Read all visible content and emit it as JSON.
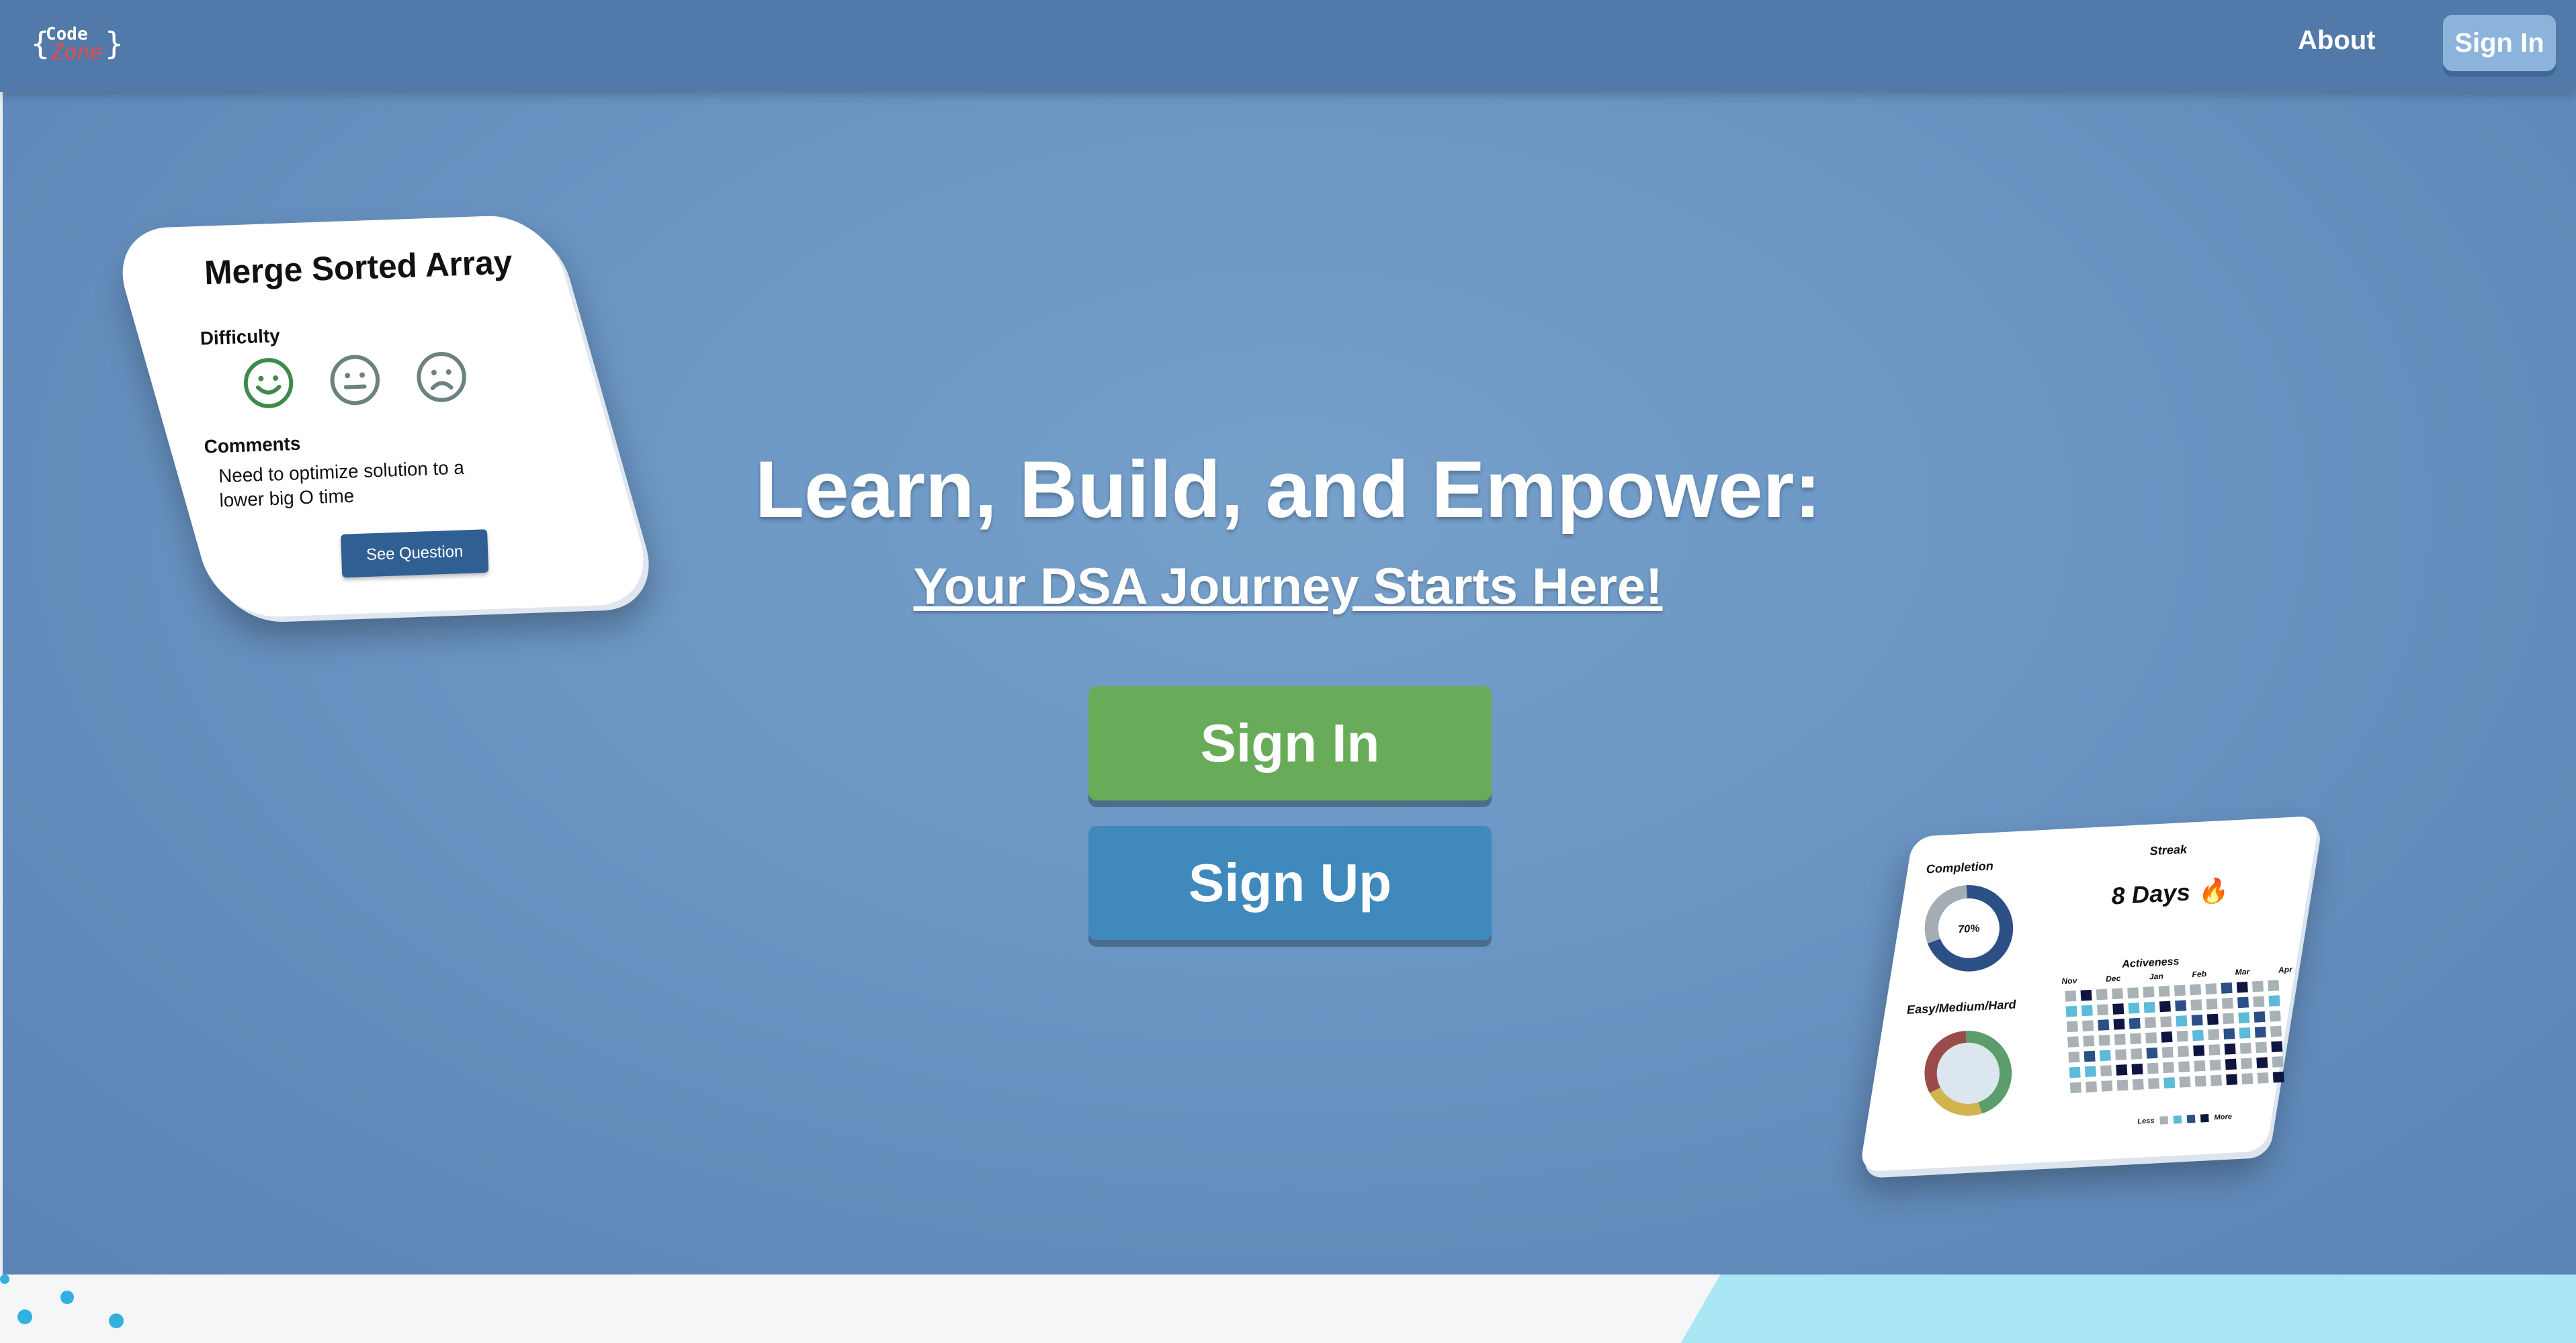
{
  "nav": {
    "logo_top": "Code",
    "logo_bottom": "Zone",
    "logo_brace_left": "{",
    "logo_brace_right": "}",
    "about": "About",
    "signin": "Sign In"
  },
  "hero": {
    "headline": "Learn, Build, and Empower:",
    "subline": "Your DSA Journey Starts Here!",
    "signin_button": "Sign In",
    "signup_button": "Sign Up"
  },
  "question_card": {
    "title": "Merge Sorted Array",
    "difficulty_label": "Difficulty",
    "faces": [
      "smile-face-icon",
      "neutral-face-icon",
      "sad-face-icon"
    ],
    "selected_face": 0,
    "comments_label": "Comments",
    "comment_text": "Need to optimize solution to a lower big O time",
    "see_question": "See Question"
  },
  "stats_card": {
    "completion_label": "Completion",
    "completion_value": "70%",
    "completion_fraction": 0.7,
    "streak_label": "Streak",
    "streak_value": "8 Days",
    "streak_icon": "🔥",
    "difficulty_label": "Easy/Medium/Hard",
    "activeness_label": "Activeness",
    "months": [
      "Nov",
      "Dec",
      "Jan",
      "Feb",
      "Mar",
      "Apr"
    ],
    "legend_less": "Less",
    "legend_more": "More"
  },
  "colors": {
    "navbar": "#5179a9",
    "signin_green": "#68ab59",
    "signup_blue": "#3f89bd",
    "card_button": "#2f5f93",
    "logo_accent": "#e74c4c"
  }
}
